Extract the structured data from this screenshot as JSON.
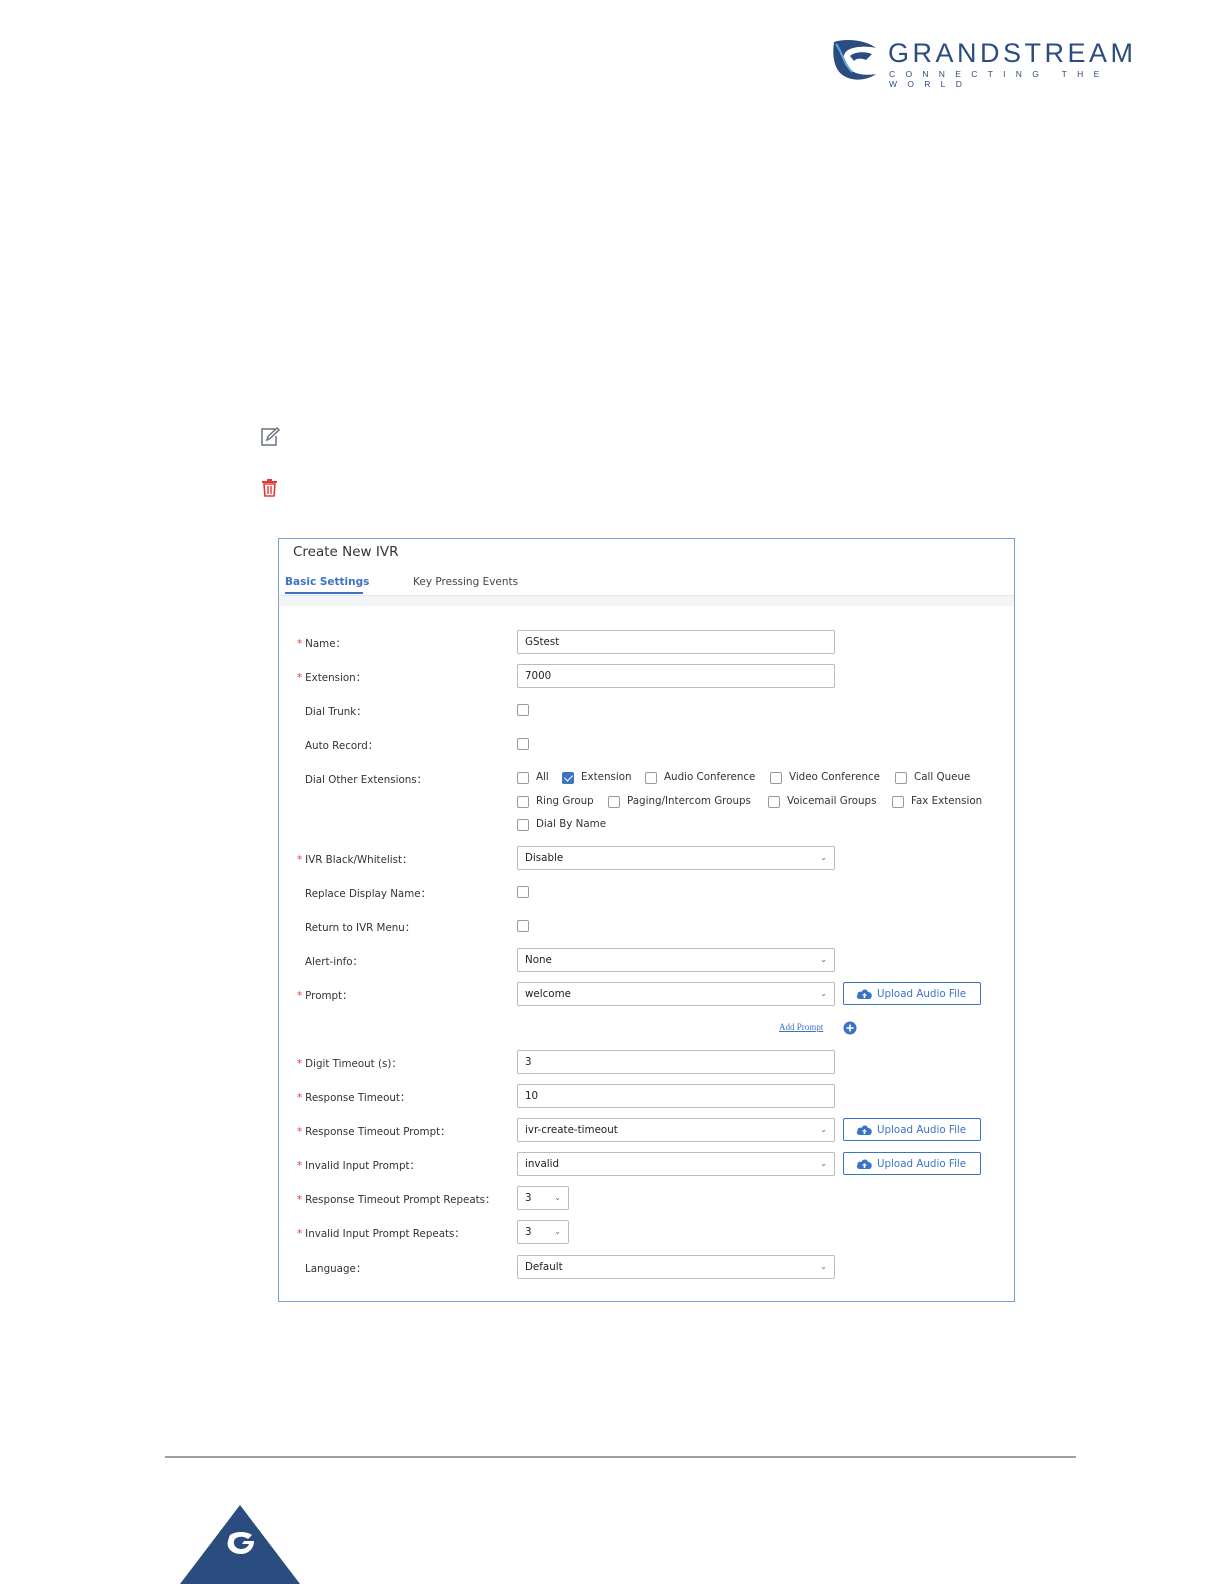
{
  "logo": {
    "brand": "GRANDSTREAM",
    "tagline": "CONNECTING THE WORLD",
    "color": "#2b4c7e"
  },
  "icons": {
    "edit": "edit-icon",
    "delete": "trash-icon"
  },
  "dialog": {
    "title": "Create New IVR",
    "tabs": [
      {
        "label": "Basic Settings",
        "active": true
      },
      {
        "label": "Key Pressing Events",
        "active": false
      }
    ],
    "accent_color": "#3b73c5",
    "fields": {
      "name": {
        "label": "Name：",
        "value": "GStest"
      },
      "extension": {
        "label": "Extension：",
        "value": "7000"
      },
      "dial_trunk": {
        "label": "Dial Trunk：",
        "checked": false
      },
      "auto_record": {
        "label": "Auto Record：",
        "checked": false
      },
      "dial_other_extensions": {
        "label": "Dial Other Extensions：",
        "options": [
          {
            "label": "All",
            "checked": false
          },
          {
            "label": "Extension",
            "checked": true
          },
          {
            "label": "Audio Conference",
            "checked": false
          },
          {
            "label": "Video Conference",
            "checked": false
          },
          {
            "label": "Call Queue",
            "checked": false
          },
          {
            "label": "Ring Group",
            "checked": false
          },
          {
            "label": "Paging/Intercom Groups",
            "checked": false
          },
          {
            "label": "Voicemail Groups",
            "checked": false
          },
          {
            "label": "Fax Extension",
            "checked": false
          },
          {
            "label": "Dial By Name",
            "checked": false
          }
        ]
      },
      "ivr_blackwhitelist": {
        "label": "IVR Black/Whitelist：",
        "value": "Disable"
      },
      "replace_display_name": {
        "label": "Replace Display Name：",
        "checked": false
      },
      "return_to_ivr_menu": {
        "label": "Return to IVR Menu：",
        "checked": false
      },
      "alert_info": {
        "label": "Alert-info：",
        "value": "None"
      },
      "prompt": {
        "label": "Prompt：",
        "value": "welcome"
      },
      "add_prompt": "Add Prompt",
      "digit_timeout": {
        "label": "Digit Timeout (s)：",
        "value": "3"
      },
      "response_timeout": {
        "label": "Response Timeout：",
        "value": "10"
      },
      "response_timeout_prompt": {
        "label": "Response Timeout Prompt：",
        "value": "ivr-create-timeout"
      },
      "invalid_input_prompt": {
        "label": "Invalid Input Prompt：",
        "value": "invalid"
      },
      "response_timeout_prompt_repeats": {
        "label": "Response Timeout Prompt Repeats：",
        "value": "3"
      },
      "invalid_input_prompt_repeats": {
        "label": "Invalid Input Prompt Repeats：",
        "value": "3"
      },
      "language": {
        "label": "Language：",
        "value": "Default"
      }
    },
    "upload_label": "Upload Audio File",
    "required_mark": "*"
  }
}
